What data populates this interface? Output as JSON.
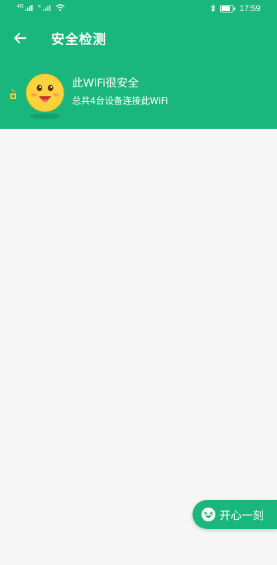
{
  "colors": {
    "primary": "#19b67d",
    "background": "#f6f6f6",
    "text_on_primary": "#ffffff",
    "mascot_face": "#ffd23c"
  },
  "status_bar": {
    "network_label_1": "4G",
    "network_label_2": "×",
    "battery_icon": "battery-icon",
    "bluetooth_icon": "bluetooth-icon",
    "wifi_icon": "wifi-icon",
    "time": "17:59"
  },
  "header": {
    "back_icon": "arrow-left-icon",
    "title": "安全检测"
  },
  "summary": {
    "mascot_icon": "smiley-mascot-icon",
    "title": "此WiFi很安全",
    "subtitle": "总共4台设备连接此WiFi"
  },
  "fab": {
    "icon": "laughing-face-icon",
    "label": "开心一刻"
  }
}
